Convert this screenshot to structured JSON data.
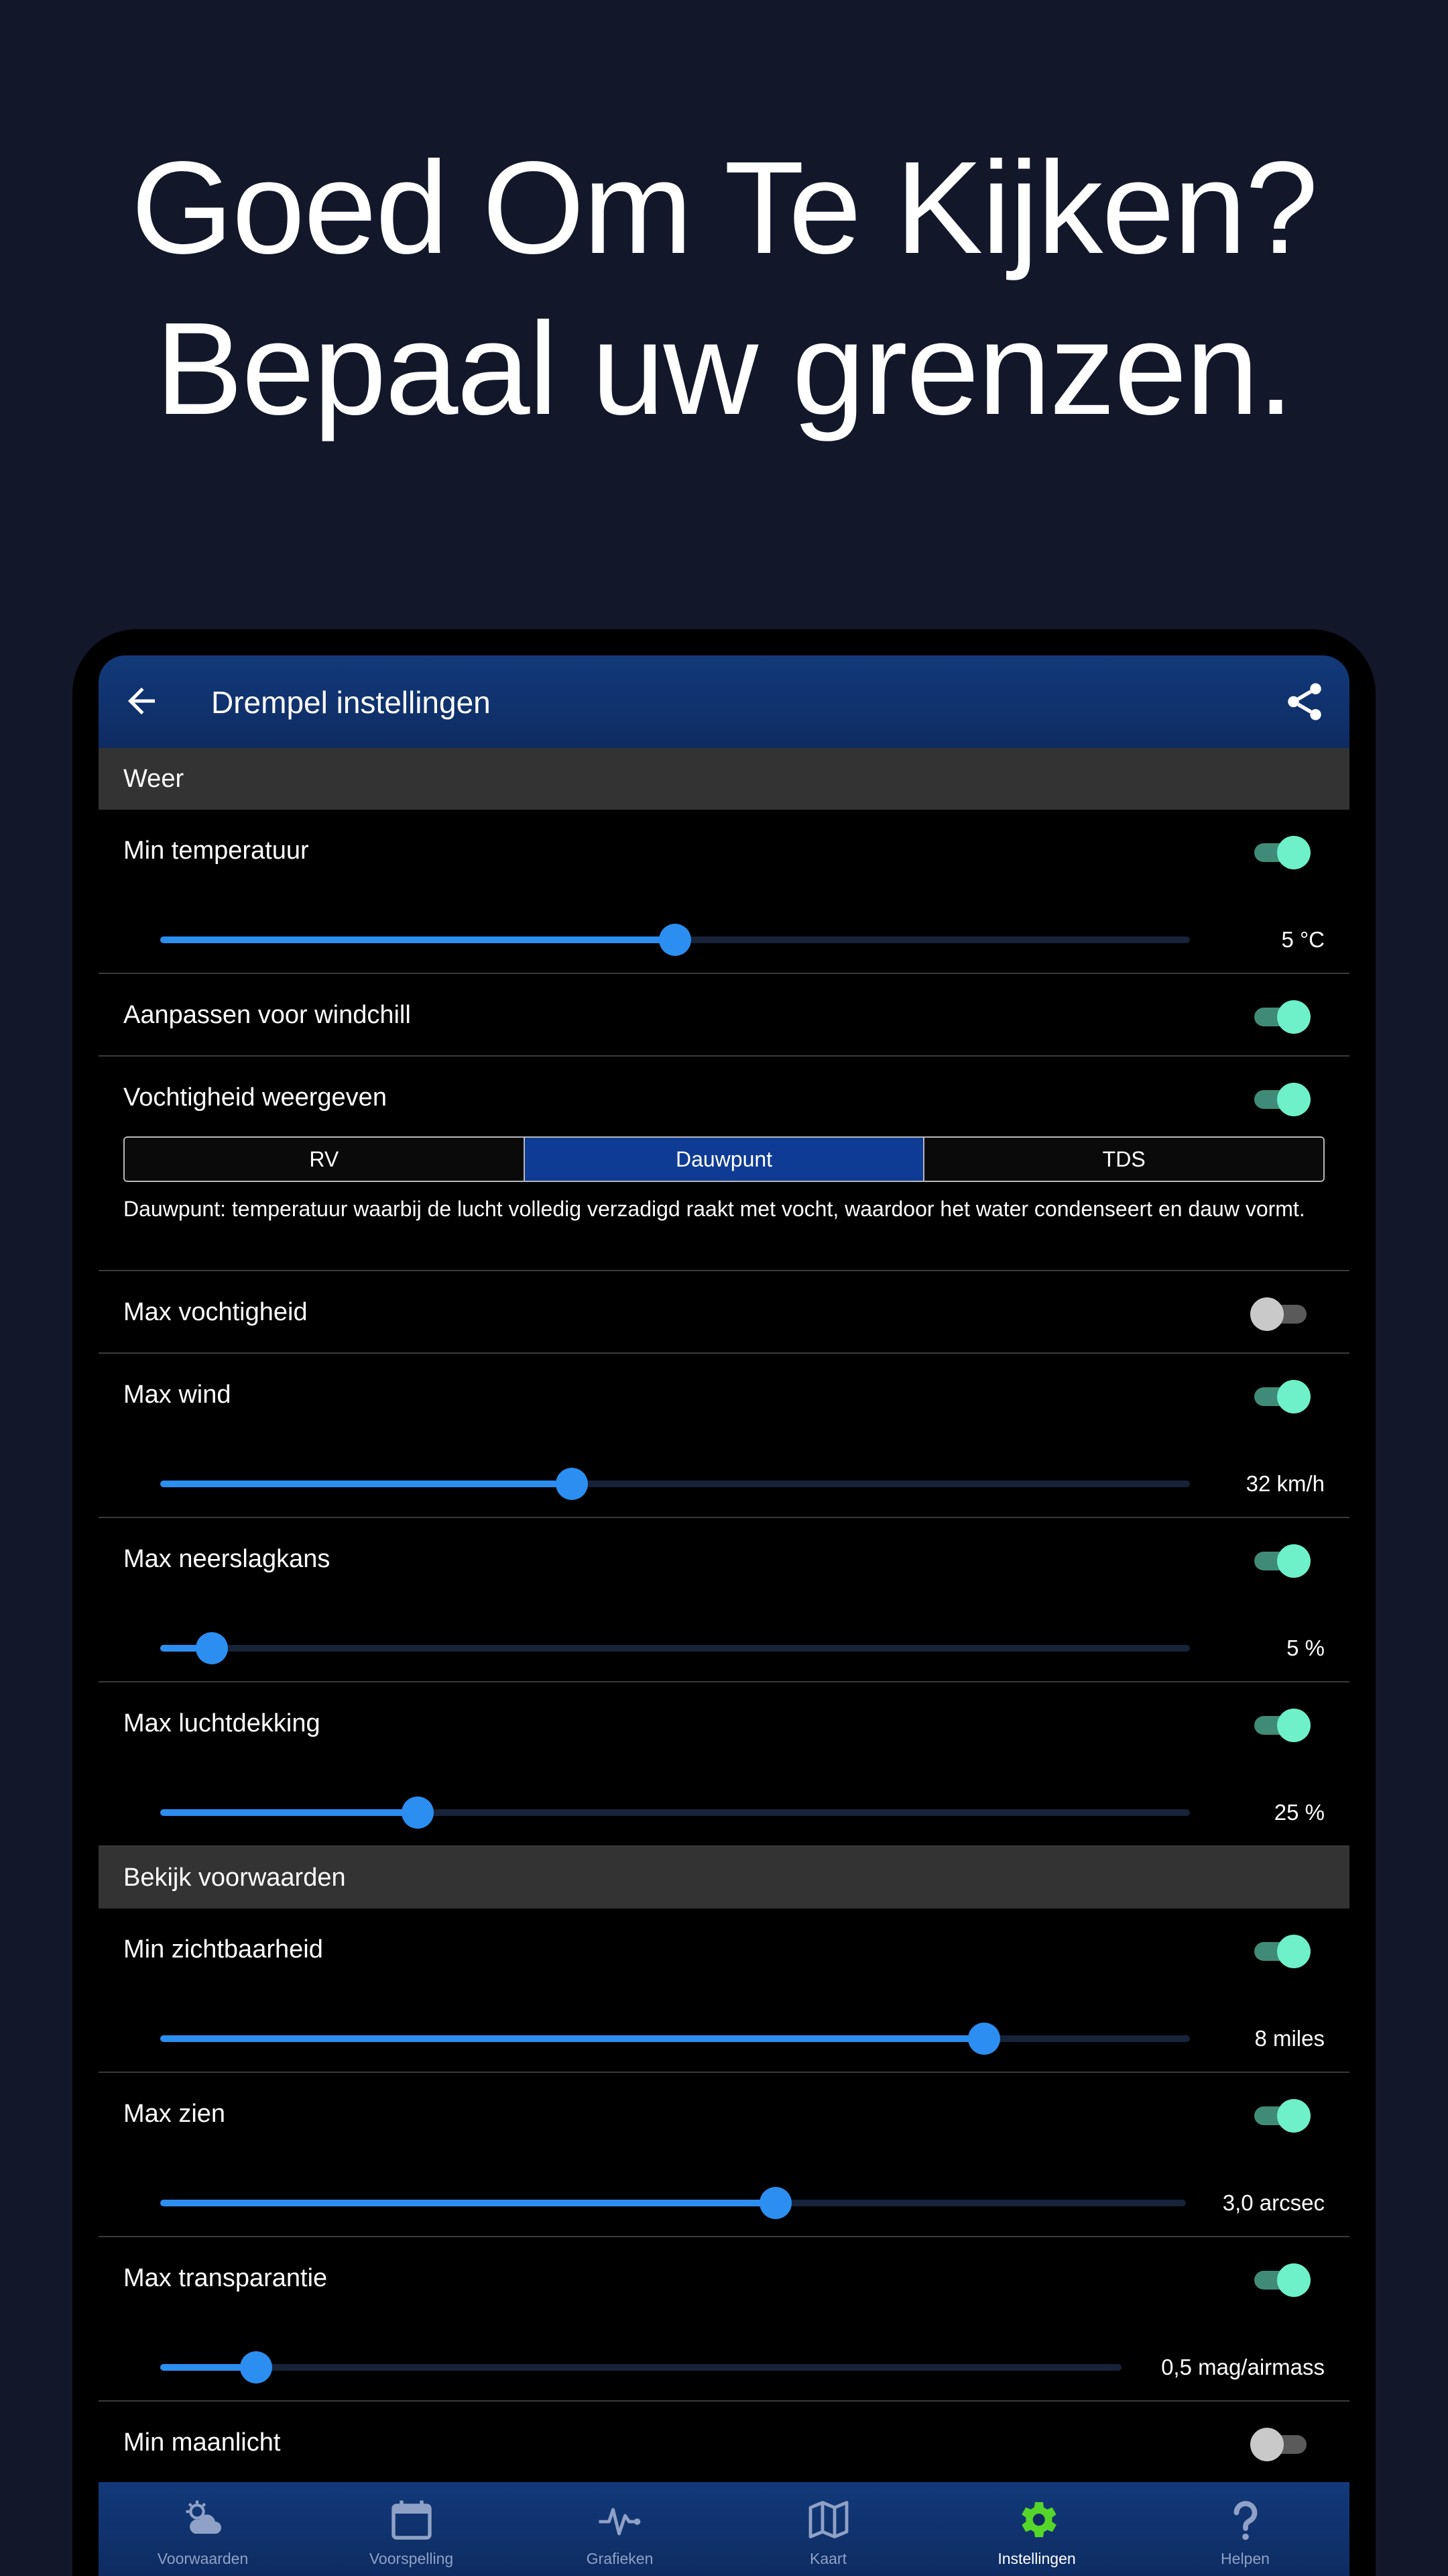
{
  "headline": {
    "line1": "Goed Om Te Kijken?",
    "line2": "Bepaal uw grenzen."
  },
  "appbar": {
    "title": "Drempel instellingen",
    "back_icon": "arrow-left-icon",
    "share_icon": "share-icon"
  },
  "sections": {
    "weer": "Weer",
    "bekijk": "Bekijk voorwaarden"
  },
  "settings": {
    "min_temp": {
      "label": "Min temperatuur",
      "enabled": true,
      "value_text": "5 °C",
      "slider": 0.5
    },
    "windchill": {
      "label": "Aanpassen voor windchill",
      "enabled": true
    },
    "humidity_display": {
      "label": "Vochtigheid weergeven",
      "enabled": true,
      "options": [
        "RV",
        "Dauwpunt",
        "TDS"
      ],
      "selected": "Dauwpunt",
      "description": "Dauwpunt: temperatuur waarbij de lucht volledig verzadigd raakt met vocht, waardoor het water condenseert en dauw vormt."
    },
    "max_humidity": {
      "label": "Max vochtigheid",
      "enabled": false
    },
    "max_wind": {
      "label": "Max wind",
      "enabled": true,
      "value_text": "32 km/h",
      "slider": 0.4
    },
    "max_precip": {
      "label": "Max neerslagkans",
      "enabled": true,
      "value_text": "5 %",
      "slider": 0.05
    },
    "max_cloud": {
      "label": "Max luchtdekking",
      "enabled": true,
      "value_text": "25 %",
      "slider": 0.25
    },
    "min_visibility": {
      "label": "Min zichtbaarheid",
      "enabled": true,
      "value_text": "8 miles",
      "slider": 0.8
    },
    "max_seeing": {
      "label": "Max zien",
      "enabled": true,
      "value_text": "3,0 arcsec",
      "slider": 0.6
    },
    "max_transparency": {
      "label": "Max transparantie",
      "enabled": true,
      "value_text": "0,5 mag/airmass",
      "slider": 0.1
    },
    "min_moonlight": {
      "label": "Min maanlicht",
      "enabled": false
    }
  },
  "bottom_nav": [
    {
      "label": "Voorwaarden",
      "icon": "partly-cloudy-icon"
    },
    {
      "label": "Voorspelling",
      "icon": "calendar-icon"
    },
    {
      "label": "Grafieken",
      "icon": "pulse-chart-icon"
    },
    {
      "label": "Kaart",
      "icon": "map-icon"
    },
    {
      "label": "Instellingen",
      "icon": "gear-icon",
      "active": true
    },
    {
      "label": "Helpen",
      "icon": "help-icon"
    }
  ],
  "colors": {
    "background": "#12172a",
    "appbar": "#12397a",
    "accent_slider": "#2b8ef0",
    "toggle_on": "#6ef0c8",
    "segment_active": "#0e3b94",
    "nav_active_icon": "#56d62a"
  }
}
